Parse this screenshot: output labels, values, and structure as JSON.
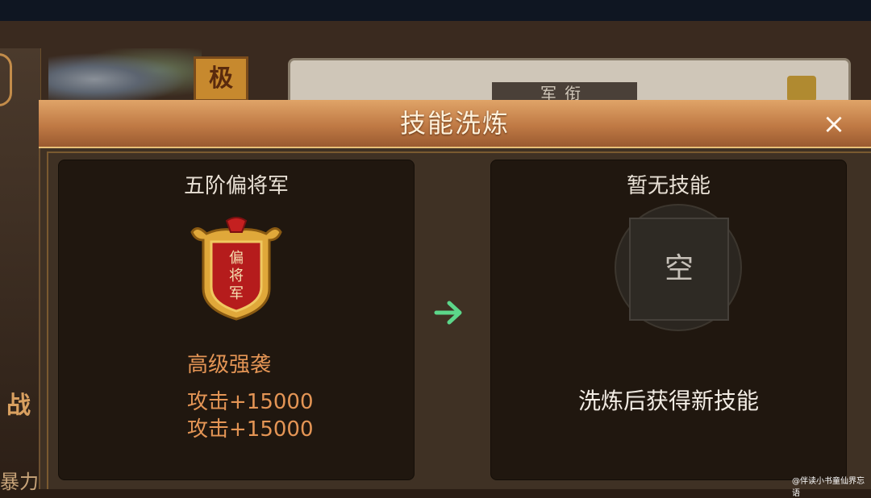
{
  "background": {
    "badge_char": "极",
    "panel_title": "军衔",
    "left_text": "战",
    "left_text2": "暴力"
  },
  "dialog": {
    "title": "技能洗炼",
    "close_label": "×"
  },
  "current": {
    "rank_name": "五阶偏将军",
    "emblem_text": "偏将军",
    "skill_name": "高级强袭",
    "effects": [
      "攻击+15000",
      "攻击+15000"
    ]
  },
  "result": {
    "title": "暂无技能",
    "slot_label": "空",
    "hint": "洗炼后获得新技能"
  },
  "watermark": "@伴读小书童仙界忘语",
  "colors": {
    "header": "#c07a45",
    "panel": "#20170f",
    "skill_text": "#e49555",
    "arrow": "#5cd68a"
  },
  "icons": {
    "arrow": "arrow-right-icon",
    "close": "close-icon",
    "emblem": "rank-emblem-icon"
  }
}
